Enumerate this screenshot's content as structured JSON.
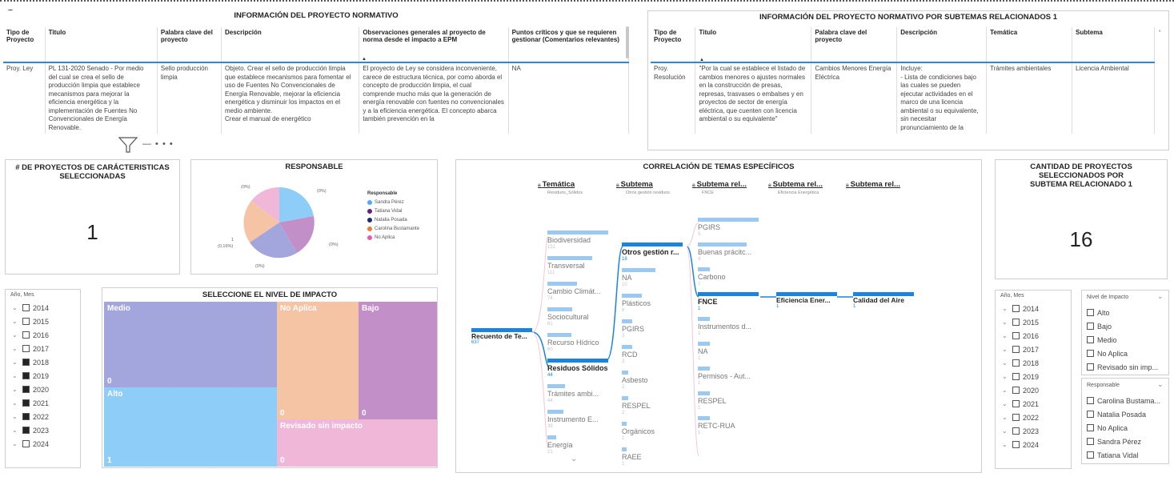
{
  "table1": {
    "title": "INFORMACIÓN DEL PROYECTO NORMATIVO",
    "headers": [
      "Tipo de Proyecto",
      "Titulo",
      "Palabra clave del proyecto",
      "Descripción",
      "Observaciones generales al proyecto de norma desde el impacto a EPM",
      "Puntos críticos y que se requieren gestionar (Comentarios relevantes)"
    ],
    "row": [
      "Proy. Ley",
      "PL 131-2020 Senado - Por medio del cual se crea el sello de producción limpia que establece mecanismos para mejorar la eficiencia energética y la implementación de Fuentes No Convencionales de Energía Renovable.",
      "Sello producción limpia",
      "Objeto. Crear el sello de producción limpia que establece mecanismos para fomentar el uso de Fuentes No Convencionales de Energía Renovable, mejorar la eficiencia energética y disminuir los impactos en el medio ambiente.\nCrear el manual de energético",
      "El proyecto de Ley se considera inconveniente, carece de estructura técnica, por como aborda el concepto de producción limpia, el cual comprende mucho más que la generación de energía renovable con fuentes no convencionales y a la eficiencia energética. El concepto abarca también prevención en la",
      "NA"
    ]
  },
  "table2": {
    "title": "INFORMACIÓN DEL PROYECTO NORMATIVO POR SUBTEMAS RELACIONADOS 1",
    "headers": [
      "Tipo de Proyecto",
      "Titulo",
      "Palabra clave del proyecto",
      "Descripción",
      "Temática",
      "Subtema"
    ],
    "row": [
      "Proy. Resolución",
      "\"Por la cual se establece el listado de cambios menores o ajustes normales en la construcción de presas, represas, trasvases o embalses y en proyectos de sector de energía eléctrica, que cuenten con licencia ambiental o su equivalente\"",
      "Cambios Menores Energía Eléctrica",
      "Incluye:\n- Lista de condiciones bajo las cuales se pueden ejecutar actividades en el marco de una licencia ambiental o su equivalente, sin necesitar pronunciamiento de la",
      "Trámites ambientales",
      "Licencia Ambiental"
    ]
  },
  "kpi1": {
    "title": "# DE PROYECTOS DE CARÁCTERISTICAS SELECCIONADAS",
    "value": "1"
  },
  "kpi2": {
    "title": "CANTIDAD DE PROYECTOS SELECCIONADOS POR SUBTEMA RELACIONADO 1",
    "value": "16"
  },
  "pie": {
    "title": "RESPONSABLE",
    "legend_title": "Responsable",
    "legend": [
      {
        "name": "Sandra Pérez",
        "color": "#8fcdf9"
      },
      {
        "name": "Tatiana Vidal",
        "color": "#c38fc9"
      },
      {
        "name": "Natalia Posada",
        "color": "#a2a6dc"
      },
      {
        "name": "Carolina Bustamante",
        "color": "#f4c4a5"
      },
      {
        "name": "No Aplica",
        "color": "#f1b7d9"
      }
    ],
    "labels": [
      "(0%)",
      "(0%)",
      "(0%)",
      "(0%)",
      "1",
      "(0,16%)"
    ]
  },
  "treemap": {
    "title": "SELECCIONE EL NIVEL DE IMPACTO",
    "tiles": [
      {
        "label": "Medio",
        "value": "0",
        "color": "#a2a6dc"
      },
      {
        "label": "Alto",
        "value": "1",
        "color": "#8fcdf9"
      },
      {
        "label": "No Aplica",
        "value": "0",
        "color": "#f4c4a5"
      },
      {
        "label": "Bajo",
        "value": "0",
        "color": "#c38fc9"
      },
      {
        "label": "Revisado sin impacto",
        "value": "0",
        "color": "#f1b7d9"
      }
    ]
  },
  "slicer_left": {
    "title": "Año, Mes",
    "years": [
      {
        "label": "2014",
        "checked": false
      },
      {
        "label": "2015",
        "checked": false
      },
      {
        "label": "2016",
        "checked": false
      },
      {
        "label": "2017",
        "checked": false
      },
      {
        "label": "2018",
        "checked": true
      },
      {
        "label": "2019",
        "checked": true
      },
      {
        "label": "2020",
        "checked": true
      },
      {
        "label": "2021",
        "checked": true
      },
      {
        "label": "2022",
        "checked": true
      },
      {
        "label": "2023",
        "checked": true
      },
      {
        "label": "2024",
        "checked": false
      }
    ]
  },
  "slicer_right": {
    "title": "Año, Mes",
    "years": [
      "2014",
      "2015",
      "2016",
      "2017",
      "2018",
      "2019",
      "2020",
      "2021",
      "2022",
      "2023",
      "2024"
    ]
  },
  "slicer_impact": {
    "title": "Nivel de Impacto",
    "items": [
      "Alto",
      "Bajo",
      "Medio",
      "No Aplica",
      "Revisado sin imp..."
    ]
  },
  "slicer_resp": {
    "title": "Responsable",
    "items": [
      "Carolina Bustama...",
      "Natalia Posada",
      "No Aplica",
      "Sandra Pérez",
      "Tatiana Vidal"
    ]
  },
  "decomp": {
    "title": "CORRELACIÓN DE TEMAS ESPECÍFICOS",
    "root": {
      "label": "Recuento de Te...",
      "value": "637"
    },
    "levels": [
      {
        "head": "Temática",
        "sub": "Residuos_Sólidos"
      },
      {
        "head": "Subtema",
        "sub": "Otros gestión residuos"
      },
      {
        "head": "Subtema rel...",
        "sub": "FNCE"
      },
      {
        "head": "Subtema rel...",
        "sub": "Eficiencia Energética"
      },
      {
        "head": "Subtema rel...",
        "sub": ""
      }
    ],
    "col1": [
      {
        "label": "Biodiversidad",
        "value": "151"
      },
      {
        "label": "Transversal",
        "value": "111"
      },
      {
        "label": "Cambio Climát...",
        "value": "74"
      },
      {
        "label": "Sociocultural",
        "value": "61"
      },
      {
        "label": "Recurso Hídrico",
        "value": "60"
      },
      {
        "label": "Residuos Sólidos",
        "value": "44"
      },
      {
        "label": "Trámites ambi...",
        "value": "44"
      },
      {
        "label": "Instrumento E...",
        "value": "39"
      },
      {
        "label": "Energía",
        "value": "21"
      }
    ],
    "col2": [
      {
        "label": "Otros gestión r...",
        "value": "18"
      },
      {
        "label": "NA",
        "value": "10"
      },
      {
        "label": "Plásticos",
        "value": "6"
      },
      {
        "label": "PGIRS",
        "value": "3"
      },
      {
        "label": "RCD",
        "value": "3"
      },
      {
        "label": "Asbesto",
        "value": "2"
      },
      {
        "label": "RESPEL",
        "value": "2"
      },
      {
        "label": "Orgánicos",
        "value": "1"
      },
      {
        "label": "RAEE",
        "value": "1"
      }
    ],
    "col3": [
      {
        "label": "PGIRS",
        "value": "5"
      },
      {
        "label": "Buenas prácitc...",
        "value": "4"
      },
      {
        "label": "Carbono",
        "value": "1"
      },
      {
        "label": "FNCE",
        "value": "1"
      },
      {
        "label": "Instrumentos d...",
        "value": "1"
      },
      {
        "label": "NA",
        "value": "1"
      },
      {
        "label": "Permisos - Aut...",
        "value": "1"
      },
      {
        "label": "RESPEL",
        "value": "1"
      },
      {
        "label": "RETC-RUA",
        "value": "1"
      }
    ],
    "col4": {
      "label": "Eficiencia Ener...",
      "value": "1"
    },
    "col5": {
      "label": "Calidad del Aire",
      "value": "1"
    }
  }
}
